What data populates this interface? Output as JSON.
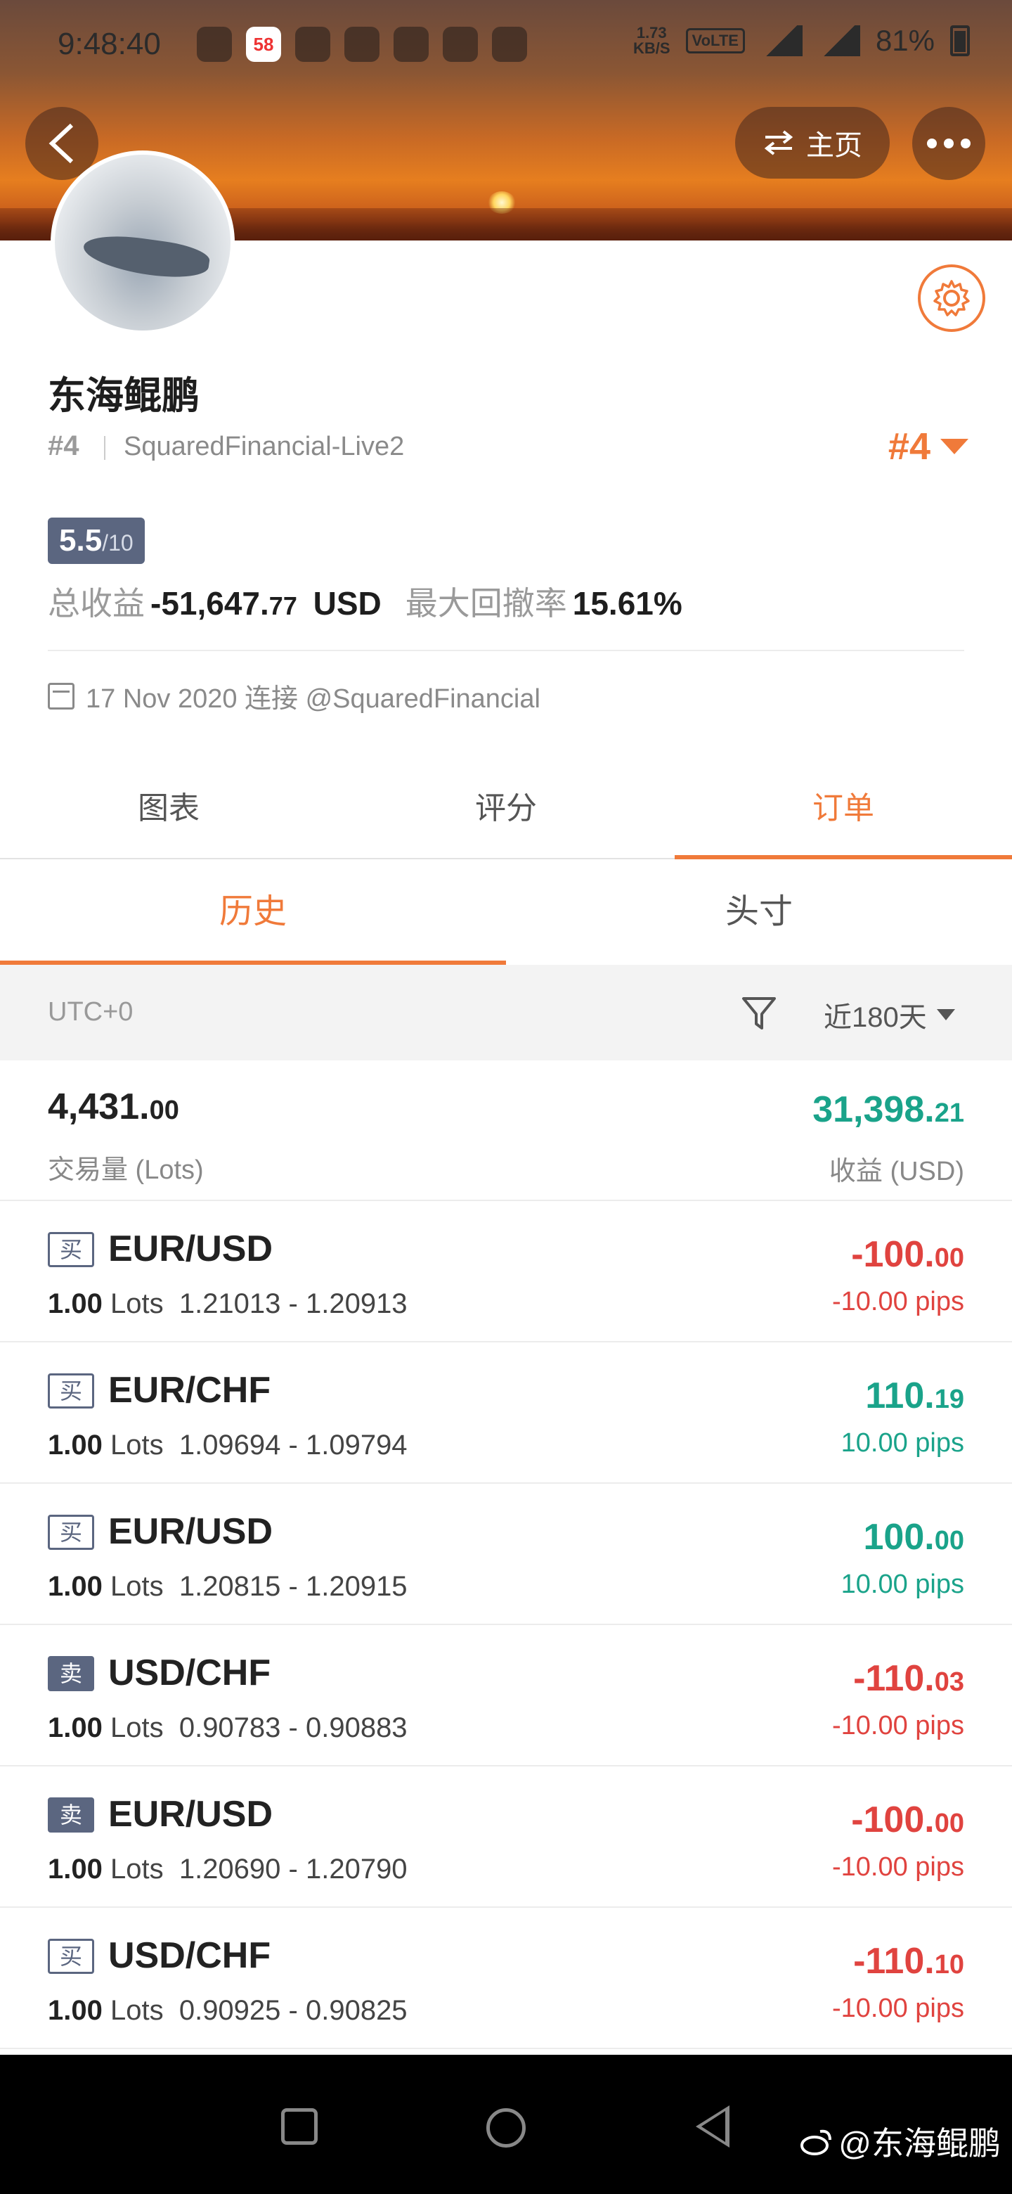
{
  "status_bar": {
    "time": "9:48:40",
    "net_speed_value": "1.73",
    "net_speed_unit": "KB/S",
    "volte": "VoLTE",
    "battery": "81%",
    "app_badge": "58"
  },
  "header": {
    "home_label": "主页"
  },
  "profile": {
    "name": "东海鲲鹏",
    "rank_small": "#4",
    "account": "SquaredFinancial-Live2",
    "rank_big": "#4",
    "score_main": "5.5",
    "score_total": "/10",
    "total_profit_label": "总收益",
    "total_profit_int": "-51,647.",
    "total_profit_dec": "77",
    "total_profit_unit": "USD",
    "max_drawdown_label": "最大回撤率",
    "max_drawdown_value": "15.61%",
    "connected_text": "17 Nov 2020 连接 @SquaredFinancial"
  },
  "main_tabs": [
    {
      "label": "图表"
    },
    {
      "label": "评分"
    },
    {
      "label": "订单"
    }
  ],
  "sub_tabs": [
    {
      "label": "历史"
    },
    {
      "label": "头寸"
    }
  ],
  "filter": {
    "timezone": "UTC+0",
    "range": "近180天"
  },
  "summary": {
    "lots_int": "4,431.",
    "lots_dec": "00",
    "lots_label": "交易量 (Lots)",
    "profit_int": "31,398.",
    "profit_dec": "21",
    "profit_label": "收益 (USD)"
  },
  "orders": [
    {
      "side": "买",
      "pair": "EUR/USD",
      "lots": "1.00",
      "lots_unit": "Lots",
      "prices": "1.21013 - 1.20913",
      "profit_int": "-100.",
      "profit_dec": "00",
      "pips": "-10.00 pips"
    },
    {
      "side": "买",
      "pair": "EUR/CHF",
      "lots": "1.00",
      "lots_unit": "Lots",
      "prices": "1.09694 - 1.09794",
      "profit_int": "110.",
      "profit_dec": "19",
      "pips": "10.00 pips"
    },
    {
      "side": "买",
      "pair": "EUR/USD",
      "lots": "1.00",
      "lots_unit": "Lots",
      "prices": "1.20815 - 1.20915",
      "profit_int": "100.",
      "profit_dec": "00",
      "pips": "10.00 pips"
    },
    {
      "side": "卖",
      "pair": "USD/CHF",
      "lots": "1.00",
      "lots_unit": "Lots",
      "prices": "0.90783 - 0.90883",
      "profit_int": "-110.",
      "profit_dec": "03",
      "pips": "-10.00 pips"
    },
    {
      "side": "卖",
      "pair": "EUR/USD",
      "lots": "1.00",
      "lots_unit": "Lots",
      "prices": "1.20690 - 1.20790",
      "profit_int": "-100.",
      "profit_dec": "00",
      "pips": "-10.00 pips"
    },
    {
      "side": "买",
      "pair": "USD/CHF",
      "lots": "1.00",
      "lots_unit": "Lots",
      "prices": "0.90925 - 0.90825",
      "profit_int": "-110.",
      "profit_dec": "10",
      "pips": "-10.00 pips"
    }
  ],
  "watermark": "@东海鲲鹏",
  "colors": {
    "accent": "#f07a3a",
    "positive": "#1aa38a",
    "negative": "#e0433f",
    "badge": "#5b6680"
  }
}
